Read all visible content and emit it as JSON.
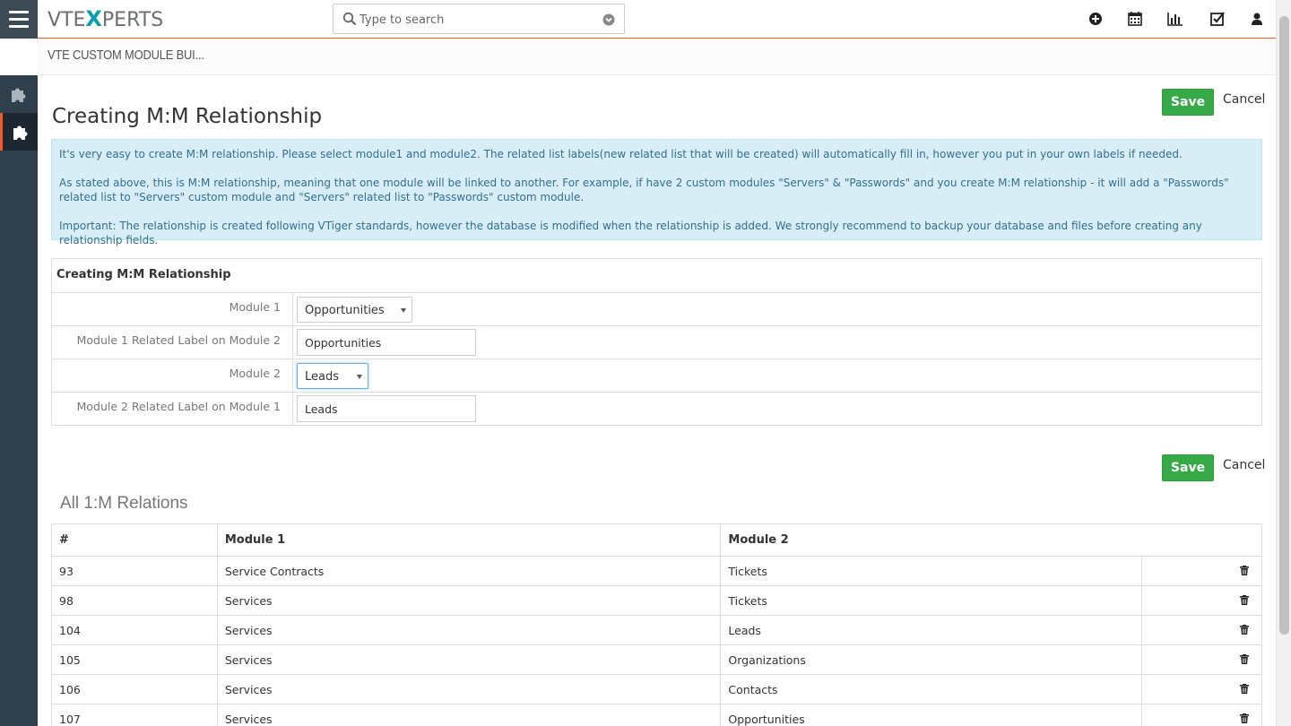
{
  "app": {
    "logo_left": "VTE",
    "logo_x": "X",
    "logo_right": "PERTS"
  },
  "search": {
    "placeholder": "Type to search"
  },
  "top_icons": [
    "plus-circle-icon",
    "calendar-icon",
    "bar-chart-icon",
    "checkbox-icon",
    "user-icon"
  ],
  "subheader": {
    "title": "VTE CUSTOM MODULE BUI..."
  },
  "sidebar": {
    "items": [
      "puzzle-icon",
      "puzzle-icon-active"
    ]
  },
  "actions": {
    "save": "Save",
    "cancel": "Cancel"
  },
  "page": {
    "title": "Creating M:M Relationship"
  },
  "info": {
    "p1": "It's very easy to create M:M relationship. Please select module1 and module2. The related list labels(new related list that will be created) will automatically fill in, however you put in your own labels if needed.",
    "p2": "As stated above, this is M:M relationship, meaning that one module will be linked to another. For example, if have 2 custom modules \"Servers\" & \"Passwords\" and you create M:M relationship - it will add a \"Passwords\" related list to \"Servers\" custom module and \"Servers\" related list to \"Passwords\" custom module.",
    "p3": "Important: The relationship is created following VTiger standards, however the database is modified when the relationship is added. We strongly recommend to backup your database and files before creating any relationship fields."
  },
  "form": {
    "heading": "Creating M:M Relationship",
    "module1_label": "Module 1",
    "module1_value": "Opportunities",
    "label1_label": "Module 1 Related Label on Module 2",
    "label1_value": "Opportunities",
    "module2_label": "Module 2",
    "module2_value": "Leads",
    "label2_label": "Module 2 Related Label on Module 1",
    "label2_value": "Leads"
  },
  "relations": {
    "title": "All 1:M Relations",
    "headers": [
      "#",
      "Module 1",
      "Module 2"
    ],
    "rows": [
      {
        "id": "93",
        "module1": "Service Contracts",
        "module2": "Tickets"
      },
      {
        "id": "98",
        "module1": "Services",
        "module2": "Tickets"
      },
      {
        "id": "104",
        "module1": "Services",
        "module2": "Leads"
      },
      {
        "id": "105",
        "module1": "Services",
        "module2": "Organizations"
      },
      {
        "id": "106",
        "module1": "Services",
        "module2": "Contacts"
      },
      {
        "id": "107",
        "module1": "Services",
        "module2": "Opportunities"
      }
    ]
  },
  "colors": {
    "accent": "#f05a28",
    "save_green": "#35aa47",
    "sidebar": "#2f3f4b",
    "info_bg": "#d9edf7",
    "info_text": "#31708f"
  }
}
